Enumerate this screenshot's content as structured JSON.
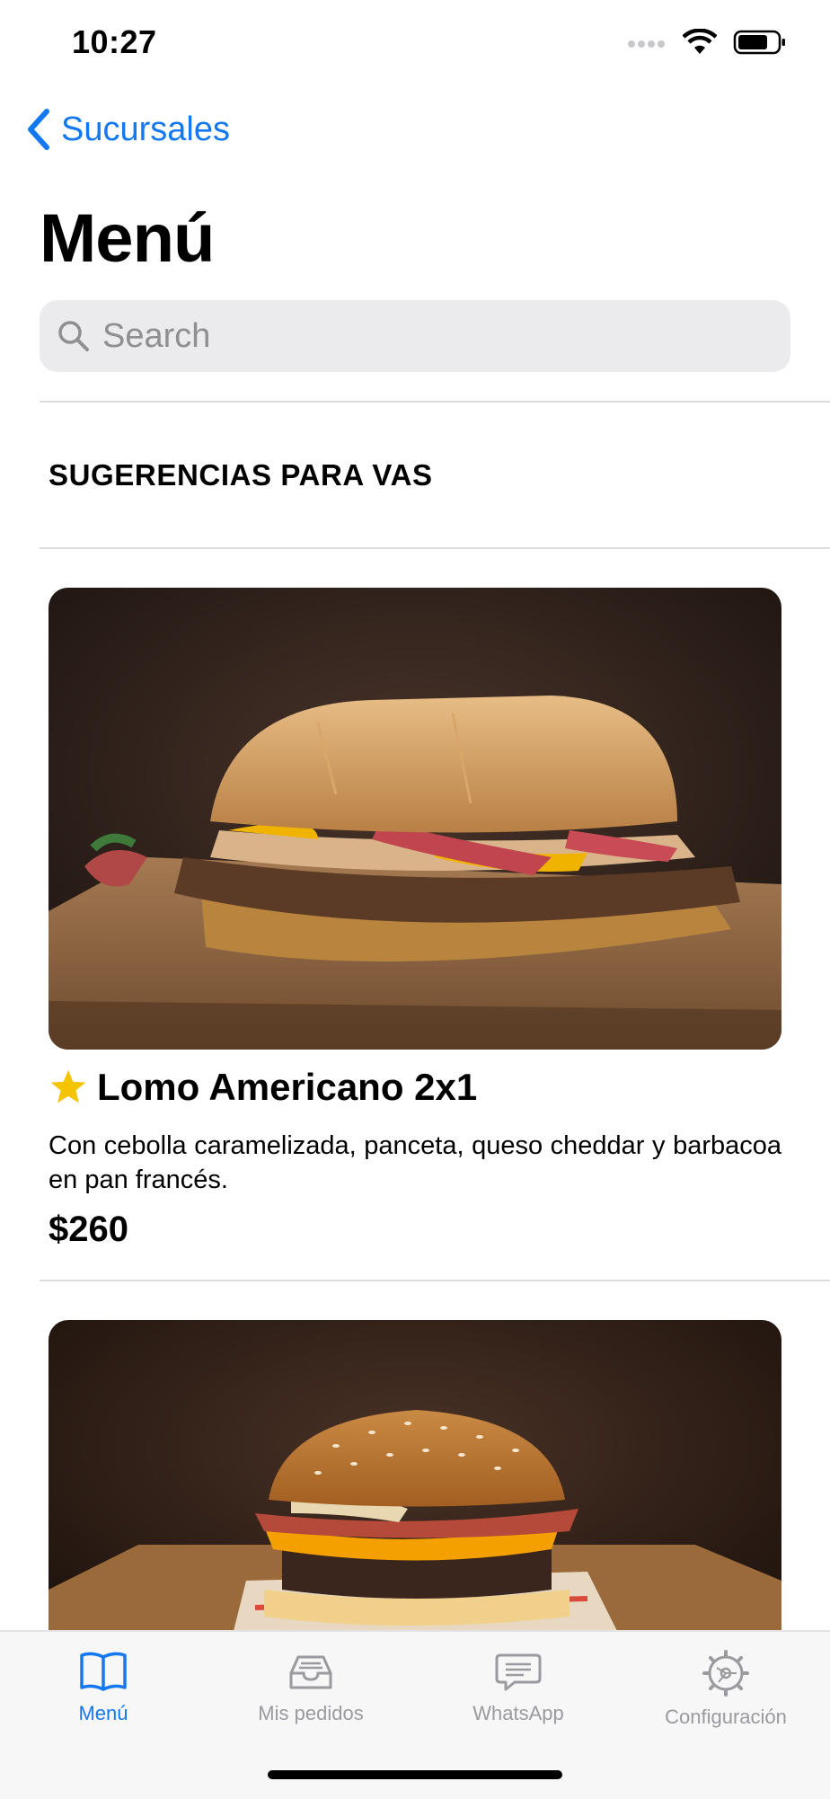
{
  "status_bar": {
    "time": "10:27"
  },
  "nav": {
    "back_label": "Sucursales"
  },
  "page": {
    "title": "Menú"
  },
  "search": {
    "placeholder": "Search"
  },
  "section": {
    "title": "SUGERENCIAS PARA VAS"
  },
  "items": [
    {
      "title": "Lomo Americano 2x1",
      "description": "Con cebolla caramelizada, panceta, queso cheddar y barbacoa en pan francés.",
      "price": "$260",
      "featured_icon": "star-icon",
      "image": "sandwich-photo"
    },
    {
      "image": "burger-photo"
    }
  ],
  "tabs": [
    {
      "label": "Menú",
      "icon": "book-icon",
      "active": true
    },
    {
      "label": "Mis pedidos",
      "icon": "tray-icon",
      "active": false
    },
    {
      "label": "WhatsApp",
      "icon": "message-icon",
      "active": false
    },
    {
      "label": "Configuración",
      "icon": "gear-icon",
      "active": false
    }
  ],
  "colors": {
    "accent": "#1478f0",
    "star": "#f5c400",
    "inactive": "#9a9a9f"
  }
}
